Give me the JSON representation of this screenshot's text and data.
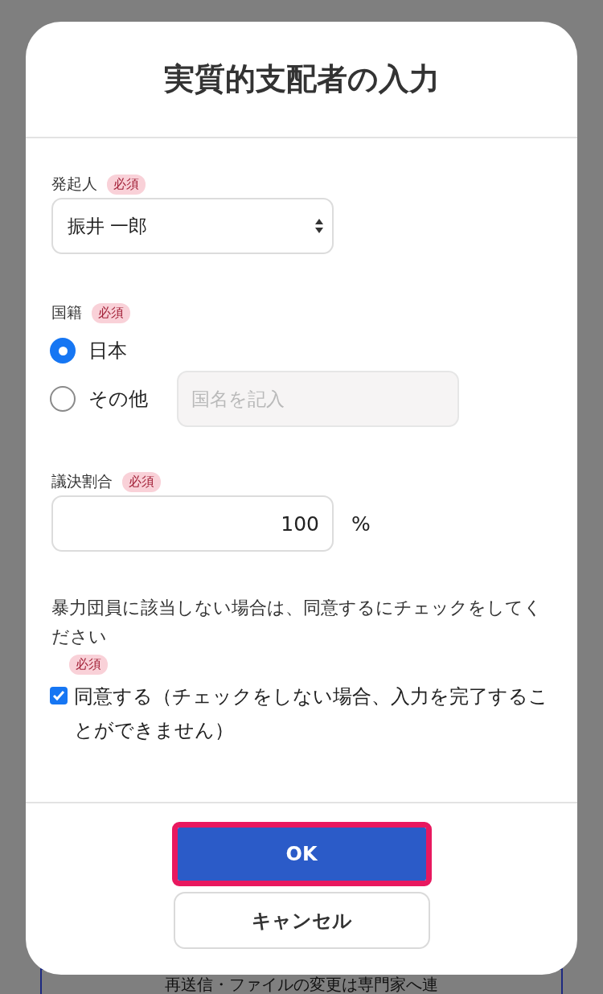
{
  "background": {
    "text": "再送信・ファイルの変更は専門家へ連"
  },
  "dialog": {
    "title": "実質的支配者の入力",
    "fields": [
      {
        "kind": "select",
        "label": "発起人",
        "required_badge": "必須",
        "value": "振井 一郎"
      },
      {
        "kind": "radio",
        "label": "国籍",
        "required_badge": "必須",
        "options": [
          {
            "label": "日本",
            "selected": true
          },
          {
            "label": "その他",
            "selected": false,
            "input": {
              "placeholder": "国名を記入",
              "disabled": true
            }
          }
        ]
      },
      {
        "kind": "number",
        "label": "議決割合",
        "required_badge": "必須",
        "value": "100",
        "unit": "%"
      },
      {
        "kind": "consent",
        "label": "暴力団員に該当しない場合は、同意するにチェックをしてください",
        "required_badge": "必須",
        "checkbox": {
          "label": "同意する（チェックをしない場合、入力を完了することができません）",
          "checked": true
        }
      }
    ],
    "buttons": [
      {
        "label": "OK",
        "kind": "primary",
        "highlighted": true
      },
      {
        "label": "キャンセル",
        "kind": "secondary",
        "highlighted": false
      }
    ]
  }
}
